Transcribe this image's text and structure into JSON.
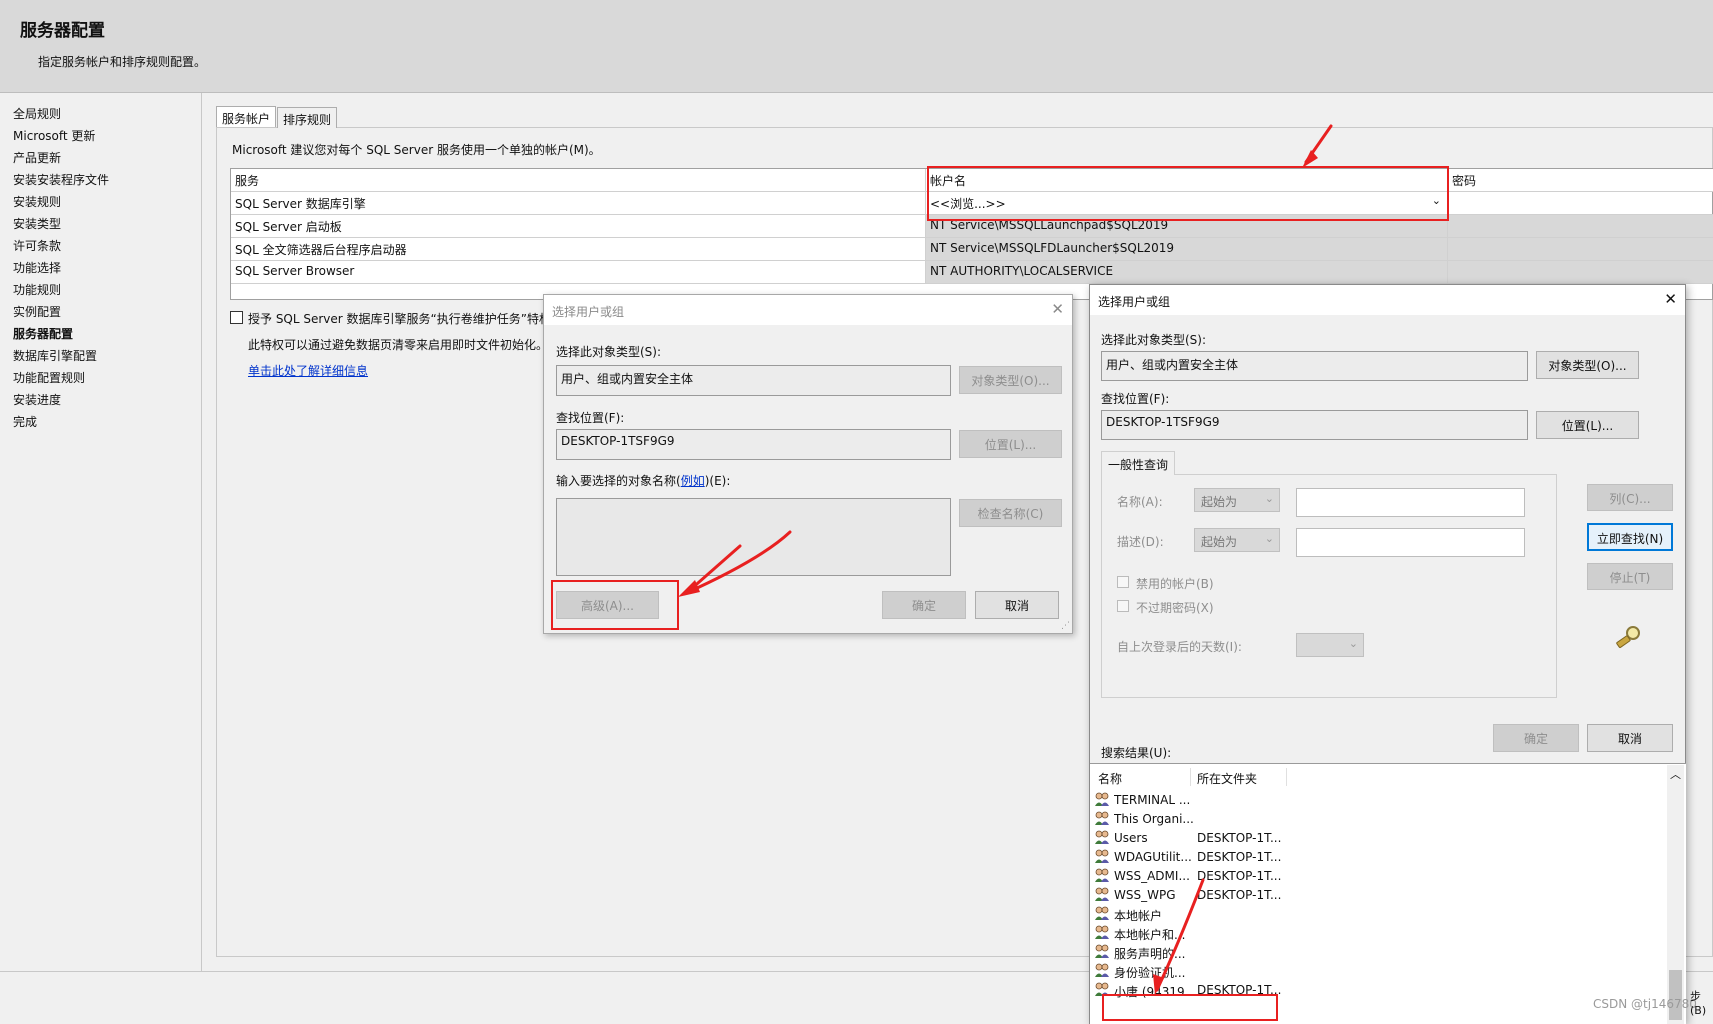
{
  "header": {
    "title": "服务器配置",
    "subtitle": "指定服务帐户和排序规则配置。"
  },
  "nav": {
    "items": [
      {
        "label": "全局规则"
      },
      {
        "label": "Microsoft 更新"
      },
      {
        "label": "产品更新"
      },
      {
        "label": "安装安装程序文件"
      },
      {
        "label": "安装规则"
      },
      {
        "label": "安装类型"
      },
      {
        "label": "许可条款"
      },
      {
        "label": "功能选择"
      },
      {
        "label": "功能规则"
      },
      {
        "label": "实例配置"
      },
      {
        "label": "服务器配置",
        "active": true
      },
      {
        "label": "数据库引擎配置"
      },
      {
        "label": "功能配置规则"
      },
      {
        "label": "安装进度"
      },
      {
        "label": "完成"
      }
    ]
  },
  "tabs": [
    {
      "label": "服务帐户",
      "selected": true
    },
    {
      "label": "排序规则",
      "selected": false
    }
  ],
  "service_accounts": {
    "recommendation": "Microsoft 建议您对每个 SQL Server 服务使用一个单独的帐户(M)。",
    "columns": [
      "服务",
      "帐户名",
      "密码"
    ],
    "rows": [
      {
        "service": "SQL Server 数据库引擎",
        "account": "<<浏览...>>",
        "password": ""
      },
      {
        "service": "SQL Server 启动板",
        "account": "NT Service\\MSSQLLaunchpad$SQL2019",
        "password": ""
      },
      {
        "service": "SQL 全文筛选器后台程序启动器",
        "account": "NT Service\\MSSQLFDLauncher$SQL2019",
        "password": ""
      },
      {
        "service": "SQL Server Browser",
        "account": "NT AUTHORITY\\LOCALSERVICE",
        "password": ""
      }
    ],
    "grant_checkbox": "授予 SQL Server 数据库引擎服务“执行卷维护任务”特权",
    "grant_checked": false,
    "grant_desc": "此特权可以通过避免数据页清零来启用即时文件初始化。",
    "details_link": "单击此处了解详细信息"
  },
  "dialog_simple": {
    "title": "选择用户或组",
    "close": "✕",
    "object_type_label": "选择此对象类型(S):",
    "object_type_value": "用户、组或内置安全主体",
    "object_type_button": "对象类型(O)...",
    "location_label": "查找位置(F):",
    "location_value": "DESKTOP-1TSF9G9",
    "location_button": "位置(L)...",
    "names_label_pre": "输入要选择的对象名称(",
    "names_label_link": "例如",
    "names_label_post": ")(E):",
    "check_names_button": "检查名称(C)",
    "advanced_button": "高级(A)...",
    "ok_button": "确定",
    "cancel_button": "取消"
  },
  "dialog_advanced": {
    "title": "选择用户或组",
    "close": "✕",
    "object_type_label": "选择此对象类型(S):",
    "object_type_value": "用户、组或内置安全主体",
    "object_type_button": "对象类型(O)...",
    "location_label": "查找位置(F):",
    "location_value": "DESKTOP-1TSF9G9",
    "location_button": "位置(L)...",
    "query_tab": "一般性查询",
    "name_label": "名称(A):",
    "name_combo": "起始为",
    "desc_label": "描述(D):",
    "desc_combo": "起始为",
    "disabled_accounts": "禁用的帐户(B)",
    "non_expiring": "不过期密码(X)",
    "days_label": "自上次登录后的天数(I):",
    "columns_button": "列(C)...",
    "find_now_button": "立即查找(N)",
    "stop_button": "停止(T)",
    "ok_button": "确定",
    "cancel_button": "取消",
    "results_label": "搜索结果(U):",
    "results_columns": [
      "名称",
      "所在文件夹"
    ],
    "results": [
      {
        "name": "TERMINAL ...",
        "folder": ""
      },
      {
        "name": "This Organi...",
        "folder": ""
      },
      {
        "name": "Users",
        "folder": "DESKTOP-1T..."
      },
      {
        "name": "WDAGUtilit...",
        "folder": "DESKTOP-1T..."
      },
      {
        "name": "WSS_ADMI...",
        "folder": "DESKTOP-1T..."
      },
      {
        "name": "WSS_WPG",
        "folder": "DESKTOP-1T..."
      },
      {
        "name": "本地帐户",
        "folder": ""
      },
      {
        "name": "本地帐户和...",
        "folder": ""
      },
      {
        "name": "服务声明的...",
        "folder": ""
      },
      {
        "name": "身份验证机...",
        "folder": ""
      },
      {
        "name": "小唐 (94319...",
        "folder": "DESKTOP-1T..."
      }
    ]
  },
  "watermark": "CSDN @tj146780",
  "edge_text": "步(B)"
}
